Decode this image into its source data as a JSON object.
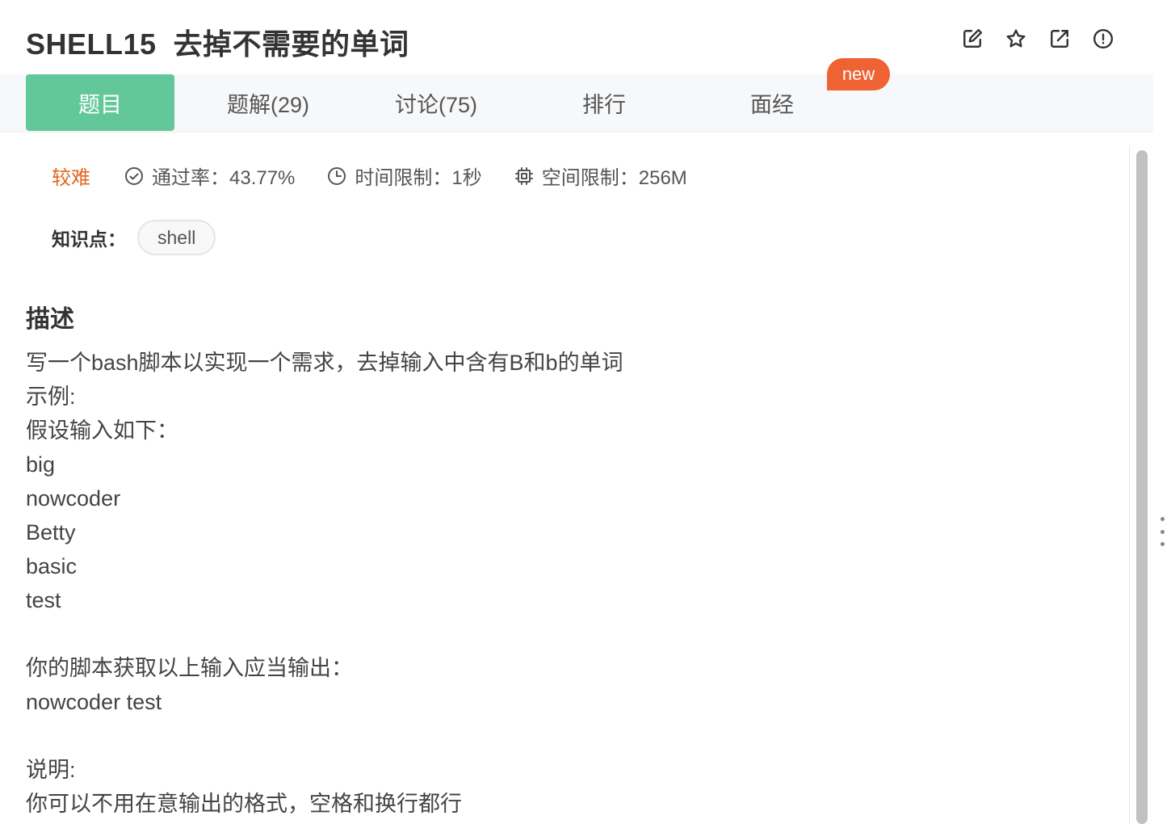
{
  "header": {
    "title": "SHELL15  去掉不需要的单词",
    "actions": [
      {
        "icon": "edit-icon"
      },
      {
        "icon": "star-icon"
      },
      {
        "icon": "share-icon"
      },
      {
        "icon": "report-icon"
      }
    ]
  },
  "tabs": [
    {
      "label": "题目",
      "active": true
    },
    {
      "label": "题解(29)",
      "active": false
    },
    {
      "label": "讨论(75)",
      "active": false
    },
    {
      "label": "排行",
      "active": false
    },
    {
      "label": "面经",
      "active": false,
      "badge": "new"
    }
  ],
  "meta": {
    "difficulty": "较难",
    "pass_rate": "通过率：43.77%",
    "time_limit": "时间限制：1秒",
    "space_limit": "空间限制：256M"
  },
  "knowledge": {
    "label": "知识点：",
    "tags": [
      "shell"
    ]
  },
  "description": {
    "title": "描述",
    "lines": [
      "写一个bash脚本以实现一个需求，去掉输入中含有B和b的单词",
      "示例:",
      "假设输入如下：",
      "big",
      "nowcoder",
      "Betty",
      "basic",
      "test",
      "",
      "你的脚本获取以上输入应当输出：",
      "nowcoder test",
      "",
      "说明:",
      "你可以不用在意输出的格式，空格和换行都行"
    ]
  },
  "colors": {
    "active_tab": "#62c899",
    "badge": "#ee6233",
    "difficulty": "#e2651d"
  }
}
